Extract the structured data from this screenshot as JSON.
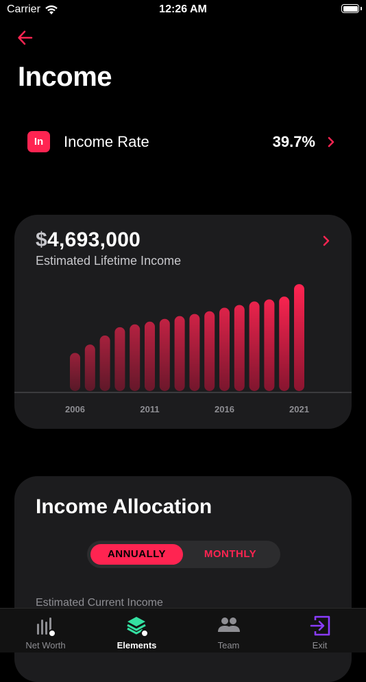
{
  "status": {
    "carrier": "Carrier",
    "time": "12:26 AM"
  },
  "page": {
    "title": "Income"
  },
  "income_rate": {
    "badge": "In",
    "label": "Income Rate",
    "value": "39.7%"
  },
  "lifetime": {
    "currency_symbol": "$",
    "amount": "4,693,000",
    "caption": "Estimated Lifetime Income"
  },
  "chart_data": {
    "type": "bar",
    "categories": [
      2006,
      2007,
      2008,
      2009,
      2010,
      2011,
      2012,
      2013,
      2014,
      2015,
      2016,
      2017,
      2018,
      2019,
      2020,
      2021
    ],
    "values": [
      55,
      67,
      80,
      92,
      96,
      100,
      104,
      108,
      111,
      115,
      120,
      124,
      129,
      132,
      136,
      154
    ],
    "xticks": [
      "2006",
      "2011",
      "2016",
      "2021"
    ],
    "title": "",
    "xlabel": "",
    "ylabel": "",
    "ylim": [
      0,
      160
    ],
    "grid": false,
    "colors": {
      "bar_top": "#ff2451",
      "bar_bottom_start": "#8a1530"
    }
  },
  "allocation": {
    "title": "Income Allocation",
    "toggle": {
      "annually": "ANNUALLY",
      "monthly": "MONTHLY",
      "selected": "annually"
    },
    "caption": "Estimated Current Income"
  },
  "tabs": [
    {
      "label": "Net Worth",
      "icon": "net-worth-chart-icon",
      "active": false
    },
    {
      "label": "Elements",
      "icon": "layers-icon",
      "active": true
    },
    {
      "label": "Team",
      "icon": "team-icon",
      "active": false
    },
    {
      "label": "Exit",
      "icon": "exit-icon",
      "active": false
    }
  ],
  "colors": {
    "accent": "#ff2451",
    "card": "#1c1c1e",
    "background": "#000000",
    "exit": "#8a3cff",
    "elements": "#34e0a1"
  }
}
